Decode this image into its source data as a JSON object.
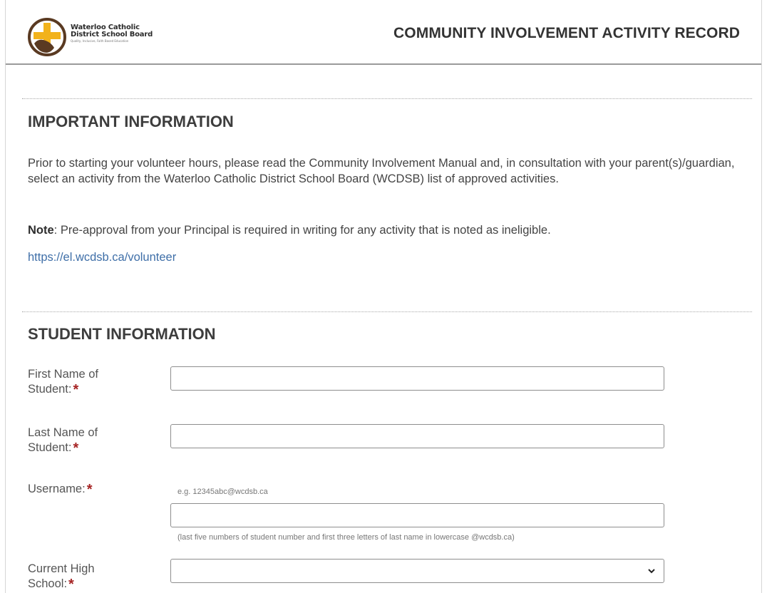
{
  "header": {
    "logo_line1": "Waterloo Catholic",
    "logo_line2": "District School Board",
    "logo_tagline": "Quality, Inclusive, Faith Based Education",
    "title": "COMMUNITY INVOLVEMENT ACTIVITY RECORD"
  },
  "important": {
    "title": "IMPORTANT INFORMATION",
    "paragraph": "Prior to starting your volunteer hours, please read the Community Involvement Manual and, in consultation with your parent(s)/guardian, select an activity from the Waterloo Catholic District School Board (WCDSB) list of approved activities.",
    "note_label": "Note",
    "note_text": ":  Pre-approval from your Principal is required in writing for any activity that is noted as ineligible.",
    "link": "https://el.wcdsb.ca/volunteer"
  },
  "student": {
    "title": "STUDENT INFORMATION",
    "first_name": {
      "label_line1": "First Name of",
      "label_line2": "Student:",
      "value": ""
    },
    "last_name": {
      "label_line1": "Last Name of",
      "label_line2": "Student:",
      "value": ""
    },
    "username": {
      "label": "Username:",
      "example": "e.g. 12345abc@wcdsb.ca",
      "value": "",
      "help": "(last five numbers of student number and first three letters of last name in lowercase @wcdsb.ca)"
    },
    "school": {
      "label_line1": "Current High",
      "label_line2": "School:",
      "selected": ""
    },
    "required_mark": "*"
  },
  "colors": {
    "required": "#a62424",
    "link": "#3f6fa8",
    "logo_gold": "#f2b21b",
    "logo_brown": "#5a3a22"
  }
}
